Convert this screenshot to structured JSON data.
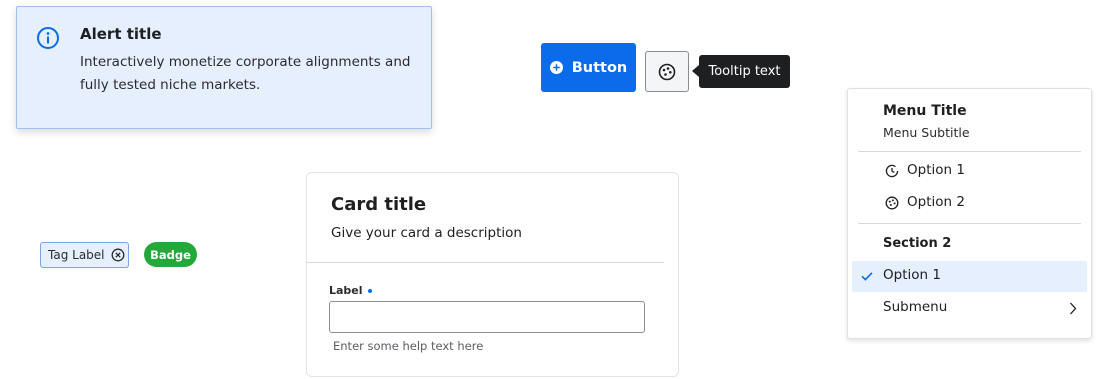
{
  "alert": {
    "icon": "info-circle-icon",
    "title": "Alert title",
    "body": "Interactively monetize corporate alignments and fully tested niche markets."
  },
  "primary_button": {
    "icon": "plus-circle-icon",
    "label": "Button"
  },
  "icon_button": {
    "icon": "palette-icon"
  },
  "tooltip": {
    "text": "Tooltip text"
  },
  "tag": {
    "label": "Tag Label",
    "close_icon": "close-circle-icon"
  },
  "badge": {
    "label": "Badge",
    "color": "#23a93a"
  },
  "card": {
    "title": "Card title",
    "description": "Give your card a description",
    "field": {
      "label": "Label",
      "required": true,
      "value": "",
      "help_text": "Enter some help text here"
    }
  },
  "menu": {
    "title": "Menu Title",
    "subtitle": "Menu Subtitle",
    "group1": [
      {
        "label": "Option 1",
        "icon": "history-icon"
      },
      {
        "label": "Option 2",
        "icon": "palette-icon"
      }
    ],
    "section2": {
      "title": "Section 2",
      "items": [
        {
          "label": "Option 1",
          "selected": true
        },
        {
          "label": "Submenu",
          "has_submenu": true
        }
      ]
    }
  },
  "colors": {
    "primary": "#0a6ceb",
    "alert_bg": "#e5effd",
    "tooltip_bg": "#1e1f21",
    "badge_success": "#23a93a"
  }
}
